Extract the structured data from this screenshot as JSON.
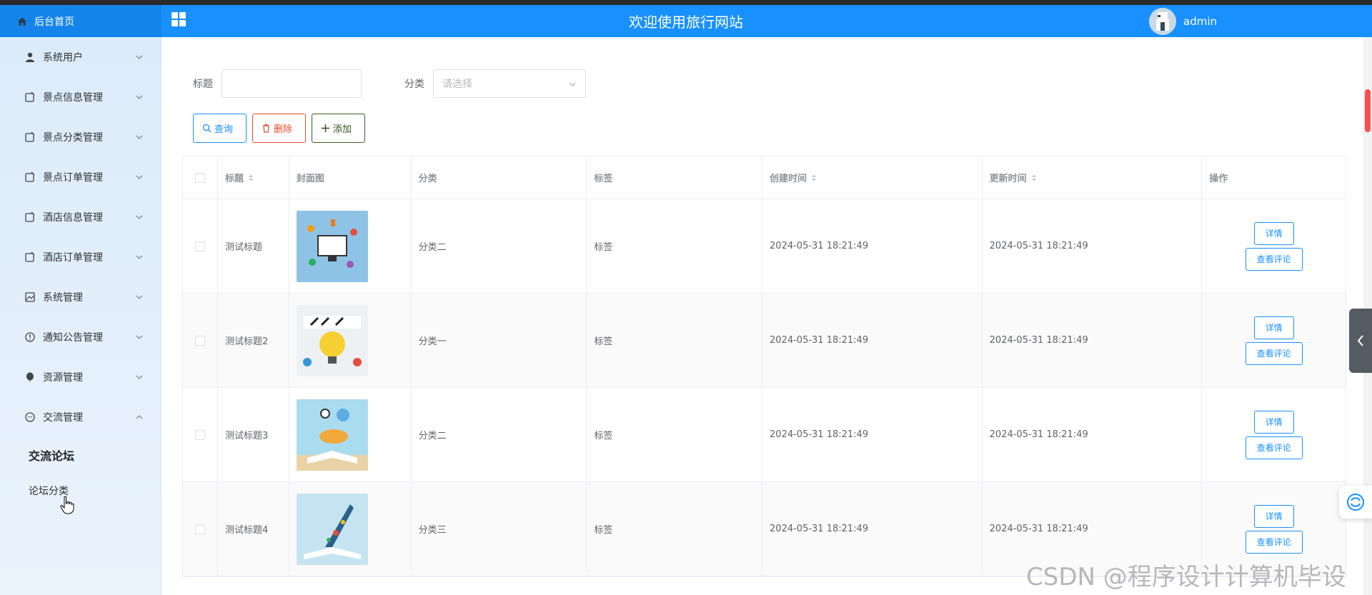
{
  "header": {
    "home_label": "后台首页",
    "title": "欢迎使用旅行网站",
    "username": "admin",
    "bg_color": "#1890ff"
  },
  "sidebar": {
    "items": [
      {
        "label": "系统用户",
        "icon": "user-icon"
      },
      {
        "label": "景点信息管理",
        "icon": "doc-icon"
      },
      {
        "label": "景点分类管理",
        "icon": "doc-icon"
      },
      {
        "label": "景点订单管理",
        "icon": "doc-icon"
      },
      {
        "label": "酒店信息管理",
        "icon": "doc-icon"
      },
      {
        "label": "酒店订单管理",
        "icon": "doc-icon"
      },
      {
        "label": "系统管理",
        "icon": "image-icon"
      },
      {
        "label": "通知公告管理",
        "icon": "info-icon"
      },
      {
        "label": "资源管理",
        "icon": "balloon-icon"
      },
      {
        "label": "交流管理",
        "icon": "chat-icon"
      }
    ],
    "subitems": [
      {
        "label": "交流论坛",
        "active": true
      },
      {
        "label": "论坛分类",
        "active": false
      }
    ]
  },
  "search": {
    "title_label": "标题",
    "title_value": "",
    "category_label": "分类",
    "category_placeholder": "请选择"
  },
  "actions": {
    "query_label": "查询",
    "delete_label": "删除",
    "add_label": "添加"
  },
  "table": {
    "headers": [
      "标题",
      "封面图",
      "分类",
      "标签",
      "创建时间",
      "更新时间",
      "操作"
    ],
    "detail_label": "详情",
    "comment_label": "查看评论",
    "rows": [
      {
        "title": "测试标题",
        "category": "分类二",
        "tag": "标签",
        "created": "2024-05-31 18:21:49",
        "updated": "2024-05-31 18:21:49"
      },
      {
        "title": "测试标题2",
        "category": "分类一",
        "tag": "标签",
        "created": "2024-05-31 18:21:49",
        "updated": "2024-05-31 18:21:49"
      },
      {
        "title": "测试标题3",
        "category": "分类二",
        "tag": "标签",
        "created": "2024-05-31 18:21:49",
        "updated": "2024-05-31 18:21:49"
      },
      {
        "title": "测试标题4",
        "category": "分类三",
        "tag": "标签",
        "created": "2024-05-31 18:21:49",
        "updated": "2024-05-31 18:21:49"
      }
    ]
  },
  "watermark": "CSDN @程序设计计算机毕设"
}
